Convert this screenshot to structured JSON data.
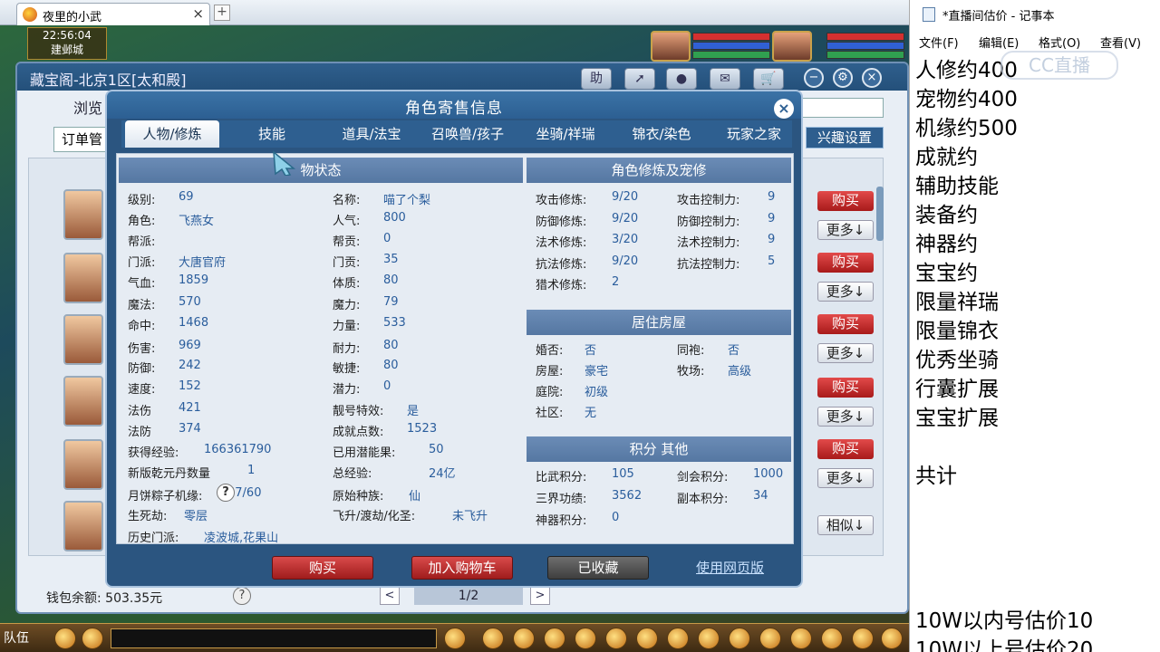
{
  "browser": {
    "tab_title": "夜里的小武",
    "tab_close": "×",
    "new_tab": "+"
  },
  "hud": {
    "time": "22:56:04",
    "location": "建邺城"
  },
  "treasure_window": {
    "title": "藏宝阁-北京1区[太和殿]",
    "toolbar": {
      "help": "助"
    },
    "browse_label": "浏览",
    "order_tab": "订单管",
    "interest_button": "兴趣设置",
    "buy_label": "购买",
    "more_label": "更多↓",
    "similar_label": "相似↓",
    "wallet": "钱包余额: 503.35元",
    "pager": "1/2",
    "help_q": "?"
  },
  "dialog": {
    "title": "角色寄售信息",
    "close": "×",
    "tabs": [
      "人物/修炼",
      "技能",
      "道具/法宝",
      "召唤兽/孩子",
      "坐骑/祥瑞",
      "锦衣/染色",
      "玩家之家"
    ],
    "sections": {
      "status": "物状态",
      "cultivation": "角色修炼及宠修",
      "house": "居住房屋",
      "points": "积分 其他"
    },
    "status_left": [
      {
        "label": "级别:",
        "value": "69"
      },
      {
        "label": "角色:",
        "value": "飞燕女"
      },
      {
        "label": "帮派:",
        "value": ""
      },
      {
        "label": "门派:",
        "value": "大唐官府"
      },
      {
        "label": "气血:",
        "value": "1859"
      },
      {
        "label": "魔法:",
        "value": "570"
      },
      {
        "label": "命中:",
        "value": "1468"
      },
      {
        "label": "伤害:",
        "value": "969"
      },
      {
        "label": "防御:",
        "value": "242"
      },
      {
        "label": "速度:",
        "value": "152"
      },
      {
        "label": "法伤",
        "value": "421"
      },
      {
        "label": "法防",
        "value": "374"
      },
      {
        "label": "获得经验:",
        "value": "166361790"
      },
      {
        "label": "新版乾元丹数量",
        "value": "1"
      },
      {
        "label": "月饼粽子机缘:",
        "value": "57/60"
      },
      {
        "label": "生死劫:",
        "value": "零层"
      },
      {
        "label": "历史门派:",
        "value": "凌波城,花果山"
      }
    ],
    "status_right": [
      {
        "label": "名称:",
        "value": "喵了个梨"
      },
      {
        "label": "人气:",
        "value": "800"
      },
      {
        "label": "帮贡:",
        "value": "0"
      },
      {
        "label": "门贡:",
        "value": "35"
      },
      {
        "label": "体质:",
        "value": "80"
      },
      {
        "label": "魔力:",
        "value": "79"
      },
      {
        "label": "力量:",
        "value": "533"
      },
      {
        "label": "耐力:",
        "value": "80"
      },
      {
        "label": "敏捷:",
        "value": "80"
      },
      {
        "label": "潜力:",
        "value": "0"
      },
      {
        "label": "靓号特效:",
        "value": "是"
      },
      {
        "label": "成就点数:",
        "value": "1523"
      },
      {
        "label": "已用潜能果:",
        "value": "50"
      },
      {
        "label": "总经验:",
        "value": "24亿"
      },
      {
        "label": "原始种族:",
        "value": "仙"
      },
      {
        "label": "飞升/渡劫/化圣:",
        "value": "未飞升"
      }
    ],
    "cultivation_left": [
      {
        "label": "攻击修炼:",
        "value": "9/20"
      },
      {
        "label": "防御修炼:",
        "value": "9/20"
      },
      {
        "label": "法术修炼:",
        "value": "3/20"
      },
      {
        "label": "抗法修炼:",
        "value": "9/20"
      },
      {
        "label": "猎术修炼:",
        "value": "2"
      }
    ],
    "cultivation_right": [
      {
        "label": "攻击控制力:",
        "value": "9"
      },
      {
        "label": "防御控制力:",
        "value": "9"
      },
      {
        "label": "法术控制力:",
        "value": "9"
      },
      {
        "label": "抗法控制力:",
        "value": "5"
      }
    ],
    "house_left": [
      {
        "label": "婚否:",
        "value": "否"
      },
      {
        "label": "房屋:",
        "value": "豪宅"
      },
      {
        "label": "庭院:",
        "value": "初级"
      },
      {
        "label": "社区:",
        "value": "无"
      }
    ],
    "house_right": [
      {
        "label": "同袍:",
        "value": "否"
      },
      {
        "label": "牧场:",
        "value": "高级"
      }
    ],
    "points_left": [
      {
        "label": "比武积分:",
        "value": "105"
      },
      {
        "label": "三界功绩:",
        "value": "3562"
      },
      {
        "label": "神器积分:",
        "value": "0"
      }
    ],
    "points_right": [
      {
        "label": "剑会积分:",
        "value": "1000"
      },
      {
        "label": "副本积分:",
        "value": "34"
      }
    ],
    "buttons": {
      "buy": "购买",
      "add_cart": "加入购物车",
      "favorited": "已收藏",
      "web_version": "使用网页版"
    }
  },
  "gamebar": {
    "team": "队伍"
  },
  "notepad": {
    "title": "*直播间估价 - 记事本",
    "menu": [
      "文件(F)",
      "编辑(E)",
      "格式(O)",
      "查看(V)"
    ],
    "lines": [
      "人修约400",
      "宠物约400",
      "机缘约500",
      "成就约",
      "辅助技能",
      "装备约",
      "神器约",
      "宝宝约",
      "限量祥瑞",
      "限量锦衣",
      "优秀坐骑",
      "行囊扩展",
      "宝宝扩展",
      "",
      "共计",
      "",
      "",
      "",
      "",
      "10W以内号估价10",
      "10W以上号估价20"
    ],
    "watermark": "CC直播"
  },
  "colors": {
    "dialog_blue": "#2c5f92",
    "value_blue": "#2a5d9c",
    "buy_red": "#d94b4b"
  }
}
